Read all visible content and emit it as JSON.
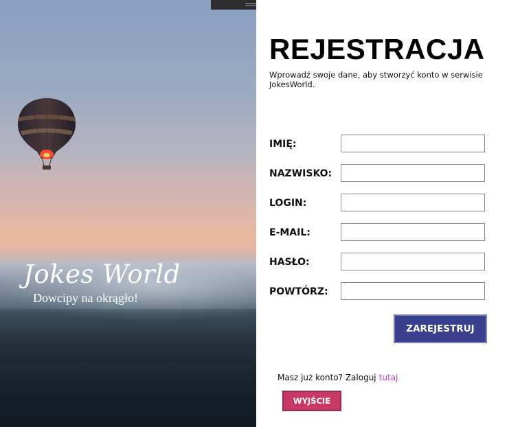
{
  "brand": {
    "name": "Jokes World",
    "tagline": "Dowcipy na okrągło!"
  },
  "form": {
    "title": "REJESTRACJA",
    "subtitle": "Wprowadź swoje dane, aby stworzyć konto w serwisie JokesWorld.",
    "fields": {
      "first_name": {
        "label": "IMIĘ:",
        "value": ""
      },
      "last_name": {
        "label": "NAZWISKO:",
        "value": ""
      },
      "login": {
        "label": "LOGIN:",
        "value": ""
      },
      "email": {
        "label": "E-MAIL:",
        "value": ""
      },
      "password": {
        "label": "HASŁO:",
        "value": ""
      },
      "repeat_password": {
        "label": "POWTÓRZ:",
        "value": ""
      }
    },
    "submit_label": "ZAREJESTRUJ"
  },
  "login_prompt": {
    "text": "Masz już konto? Zaloguj",
    "link_text": "tutaj"
  },
  "exit_label": "WYJŚCIE",
  "colors": {
    "register_button": "#3a3f8e",
    "exit_button": "#c43a64",
    "link": "#c23cc8",
    "title_bar": "#2d2d30"
  },
  "icons": {
    "window_handle": "drag-handle-icon",
    "balloon": "hot-air-balloon-image"
  }
}
